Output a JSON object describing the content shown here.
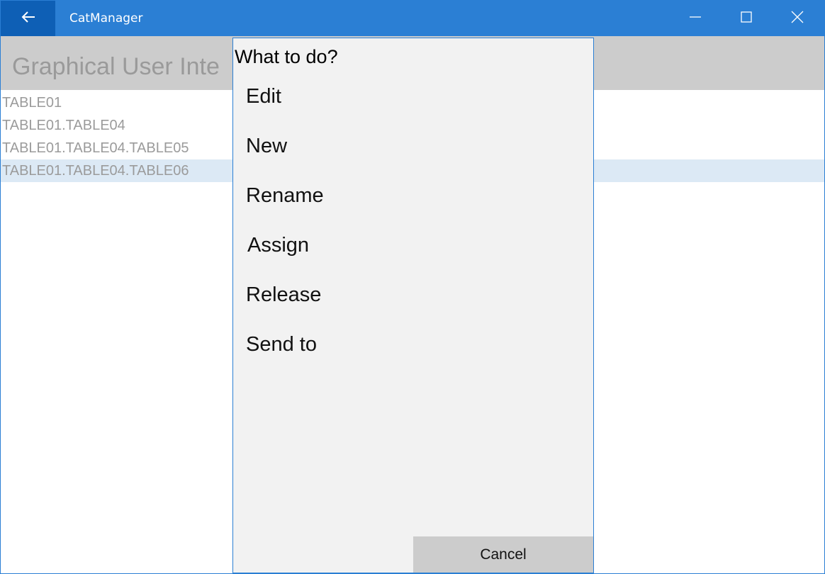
{
  "window": {
    "app_title": "CatManager",
    "accent_color": "#2b7fd4",
    "back_icon": "arrow-left-icon",
    "minimize_icon": "minimize-icon",
    "maximize_icon": "maximize-icon",
    "close_icon": "close-icon"
  },
  "header": {
    "title": "Graphical User Inte"
  },
  "tree": {
    "items": [
      {
        "label": "TABLE01"
      },
      {
        "label": "TABLE01.TABLE04"
      },
      {
        "label": "TABLE01.TABLE04.TABLE05"
      },
      {
        "label": "TABLE01.TABLE04.TABLE06",
        "selected": true
      }
    ]
  },
  "dialog": {
    "title": "What to do?",
    "items": [
      {
        "label": "Edit"
      },
      {
        "label": "New"
      },
      {
        "label": "Rename"
      },
      {
        "label": "Assign"
      },
      {
        "label": "Release"
      },
      {
        "label": "Send to"
      }
    ],
    "cancel_label": "Cancel"
  }
}
